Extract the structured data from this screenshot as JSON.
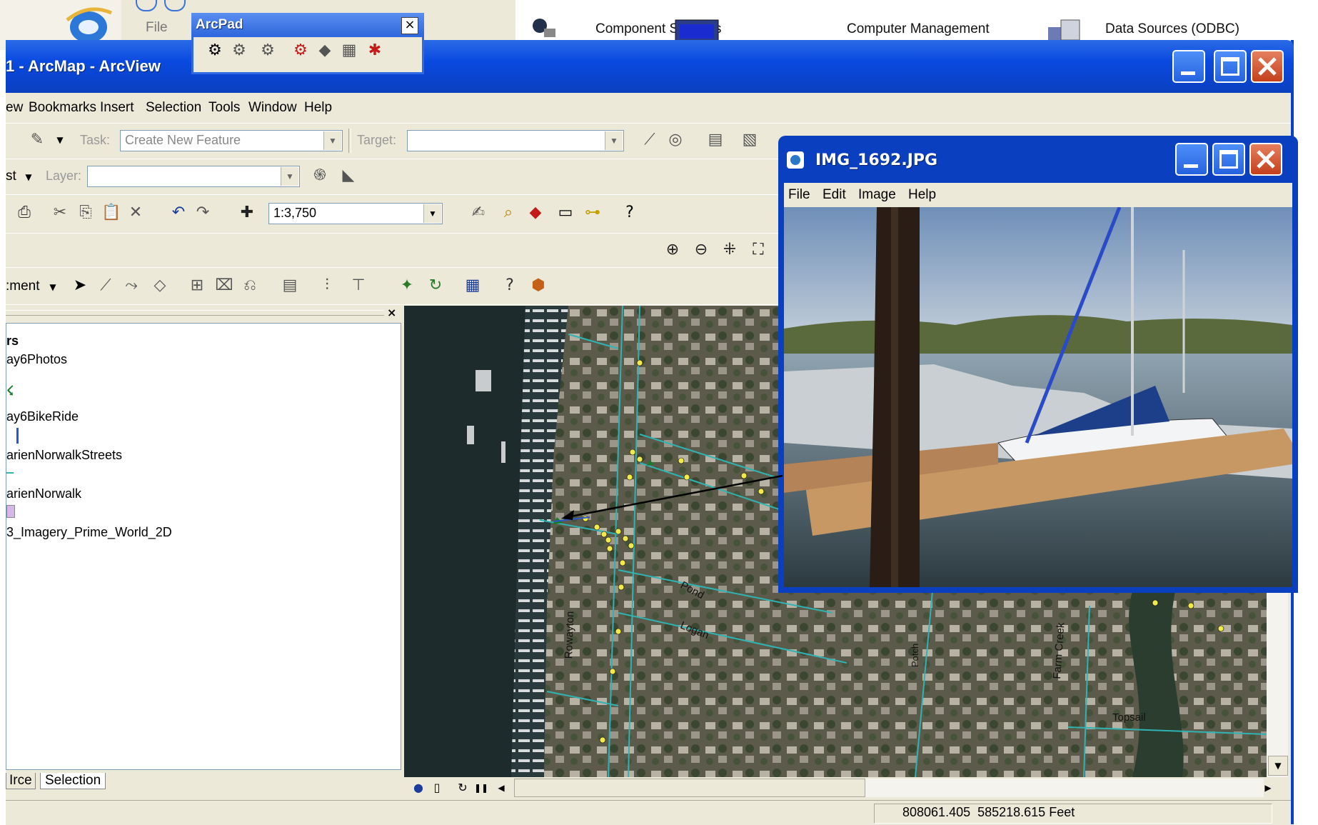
{
  "desktop": {
    "explorer_menu_file": "File",
    "admin_items": [
      "Component Services",
      "Computer Management",
      "Data Sources (ODBC)"
    ]
  },
  "arcmap": {
    "title": "1 - ArcMap - ArcView",
    "menu": [
      "ew",
      "Bookmarks",
      "Insert",
      "Selection",
      "Tools",
      "Window",
      "Help"
    ],
    "editor": {
      "task_label": "Task:",
      "task_value": "Create New Feature",
      "target_label": "Target:",
      "target_value": ""
    },
    "layer_row": {
      "dropdown_fragment": "st",
      "layer_label": "Layer:",
      "layer_value": ""
    },
    "scale_value": "1:3,750",
    "georef_fragment": ":ment",
    "toc": {
      "header": "rs",
      "layers": [
        "ay6Photos",
        "ay6BikeRide",
        "arienNorwalkStreets",
        "arienNorwalk",
        "3_Imagery_Prime_World_2D"
      ],
      "tabs": [
        "Irce",
        "Selection"
      ]
    },
    "map_labels": [
      "Pond",
      "Logan",
      "Rowayton",
      "Farm Creek",
      "Topsail",
      "Potch"
    ],
    "status_coords": "808061.405  585218.615 Feet"
  },
  "arcpad": {
    "title": "ArcPad",
    "close": "×"
  },
  "viewer": {
    "title": "IMG_1692.JPG",
    "menu": [
      "File",
      "Edit",
      "Image",
      "Help"
    ]
  },
  "colors": {
    "xp_blue": "#0a4ae0",
    "xp_face": "#ece9d8",
    "street_line": "#2fb3b3",
    "point": "#f2e94a",
    "photo_point": "#1a7a2a"
  }
}
